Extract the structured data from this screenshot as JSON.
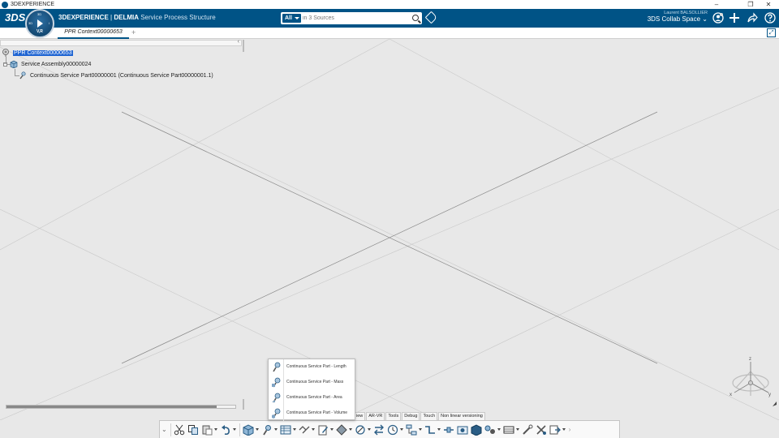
{
  "window": {
    "title": "3DEXPERIENCE",
    "controls": {
      "minimize": "–",
      "restore": "❐",
      "close": "✕"
    }
  },
  "topbar": {
    "logo": "3DS",
    "compass": {
      "label": "V,R",
      "top": "3D",
      "left": "3D",
      "right": "i"
    },
    "brand": {
      "product": "3DEXPERIENCE",
      "separator": " | ",
      "company": "DELMIA",
      "app": " Service Process Structure"
    },
    "search": {
      "scope": "All",
      "placeholder": "in 3 Sources"
    },
    "user": {
      "name": "Laurent BALSOLLIER",
      "space": "3DS Collab Space"
    },
    "icons": [
      "tag-icon",
      "user-profile-icon",
      "add-icon",
      "share-icon",
      "help-icon"
    ]
  },
  "tabs": [
    {
      "label": "PPR Context00000653",
      "active": true
    }
  ],
  "add_tab": "+",
  "tree": {
    "nodes": [
      {
        "label": "PPR Context00000653",
        "selected": true,
        "level": 0,
        "icon": "ppr-context-icon"
      },
      {
        "label": "Service Assembly00000024",
        "selected": false,
        "level": 1,
        "icon": "service-assembly-icon"
      },
      {
        "label": "Continuous Service Part00000001 (Continuous Service Part00000001.1)",
        "selected": false,
        "level": 2,
        "icon": "continuous-service-part-icon"
      }
    ],
    "expander": "–"
  },
  "flyout": {
    "items": [
      {
        "label": "Continuous Service Part - Length"
      },
      {
        "label": "Continuous Service Part - Mass"
      },
      {
        "label": "Continuous Service Part - Area"
      },
      {
        "label": "Continuous Service Part - Volume"
      }
    ]
  },
  "section_tabs": [
    "iew",
    "AR-VR",
    "Tools",
    "Debug",
    "Touch",
    "Non linear versioning"
  ],
  "compass_axes": {
    "x": "x",
    "y": "y",
    "z": "z"
  },
  "colors": {
    "brand": "#005386",
    "selection": "#1e64d2",
    "canvas": "#e8e8e8"
  }
}
